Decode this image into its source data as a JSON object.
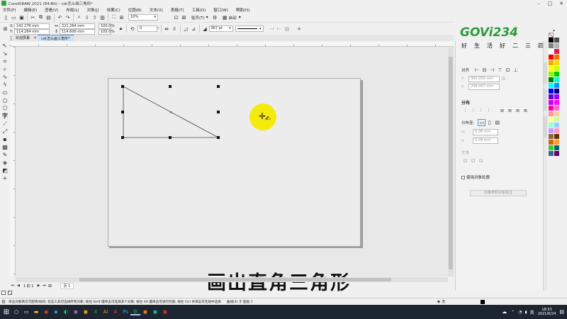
{
  "window": {
    "title": "CorelDRAW 2021 (64-Bit) - cdr怎么画三角形*"
  },
  "menu": [
    "文件(F)",
    "编辑(E)",
    "查看(V)",
    "布局(L)",
    "对象(J)",
    "效果(C)",
    "位图(B)",
    "文本(X)",
    "表格(T)",
    "工具(O)",
    "窗口(W)",
    "帮助(H)"
  ],
  "toolbar": {
    "zoom": "10%",
    "snap_label": "贴齐(T)",
    "launch_label": "启动"
  },
  "propbar": {
    "x": "142.276 mm",
    "y": "114.264 mm",
    "w": "221.264 mm",
    "h": "114.609 mm",
    "sx": "100.0",
    "sy": "100.0",
    "pct": "%",
    "angle": "0",
    "angle_unit": "°",
    "outline_width": "367 pt"
  },
  "tabs": {
    "welcome": "欢迎屏幕",
    "doc": "cdr怎么画三角形*"
  },
  "watermark": {
    "logo": "GOVi234",
    "slogan": [
      "好",
      "生",
      "活",
      "好",
      "二",
      "三",
      "四"
    ]
  },
  "panel": {
    "align_title": "对齐",
    "x_value": "380.059 mm",
    "y_value": "208.067 mm",
    "distribute_title": "分布",
    "distribute_to": "分布至:",
    "h_value": "5.08 mm",
    "v_value": "5.08 mm",
    "text_title": "文本",
    "use_obj_outline": "使用对象轮廓",
    "apply_btn": "向量参照对象标注"
  },
  "page_nav": {
    "counter": "1 的 1",
    "page_tab": "页 1"
  },
  "status": {
    "hint": "单击对象两次可旋转/倾斜; 双击工具可选择所有对象; 按住 Shift 键单击可选择多个对象; 按住 Alt 键单击可进行挖掘; 按住 Ctrl 并单击可在组中选择",
    "object": "曲线(4) 于 图层 1",
    "fill_none": "无"
  },
  "subtitle": "画出直角三角形",
  "taskbar": {
    "time": "18:33",
    "date": "2021/6/24",
    "lang": "英"
  },
  "colors": {
    "palette": [
      "#000000",
      "#4d4d4d",
      "#808080",
      "#b3b3b3",
      "#ffffff",
      "#e6194b",
      "#ff0000",
      "#ff6a00",
      "#ffa500",
      "#ffd700",
      "#ffff00",
      "#c8ff00",
      "#7fff00",
      "#00cc00",
      "#008000",
      "#00ffcc",
      "#00ffff",
      "#0099ff",
      "#0000ff",
      "#000080",
      "#6600cc",
      "#9900ff",
      "#cc00ff",
      "#ff00ff",
      "#ff0099",
      "#ff66cc",
      "#ff9999",
      "#ffcc99",
      "#ffff99",
      "#ccff99",
      "#99ffcc",
      "#99ccff",
      "#cc99ff",
      "#ff99cc",
      "#996633",
      "#663300",
      "#cc6600",
      "#ff9933",
      "#33cc33",
      "#006666",
      "#336699",
      "#660066"
    ],
    "cursor_highlight": "#f4ea00"
  }
}
